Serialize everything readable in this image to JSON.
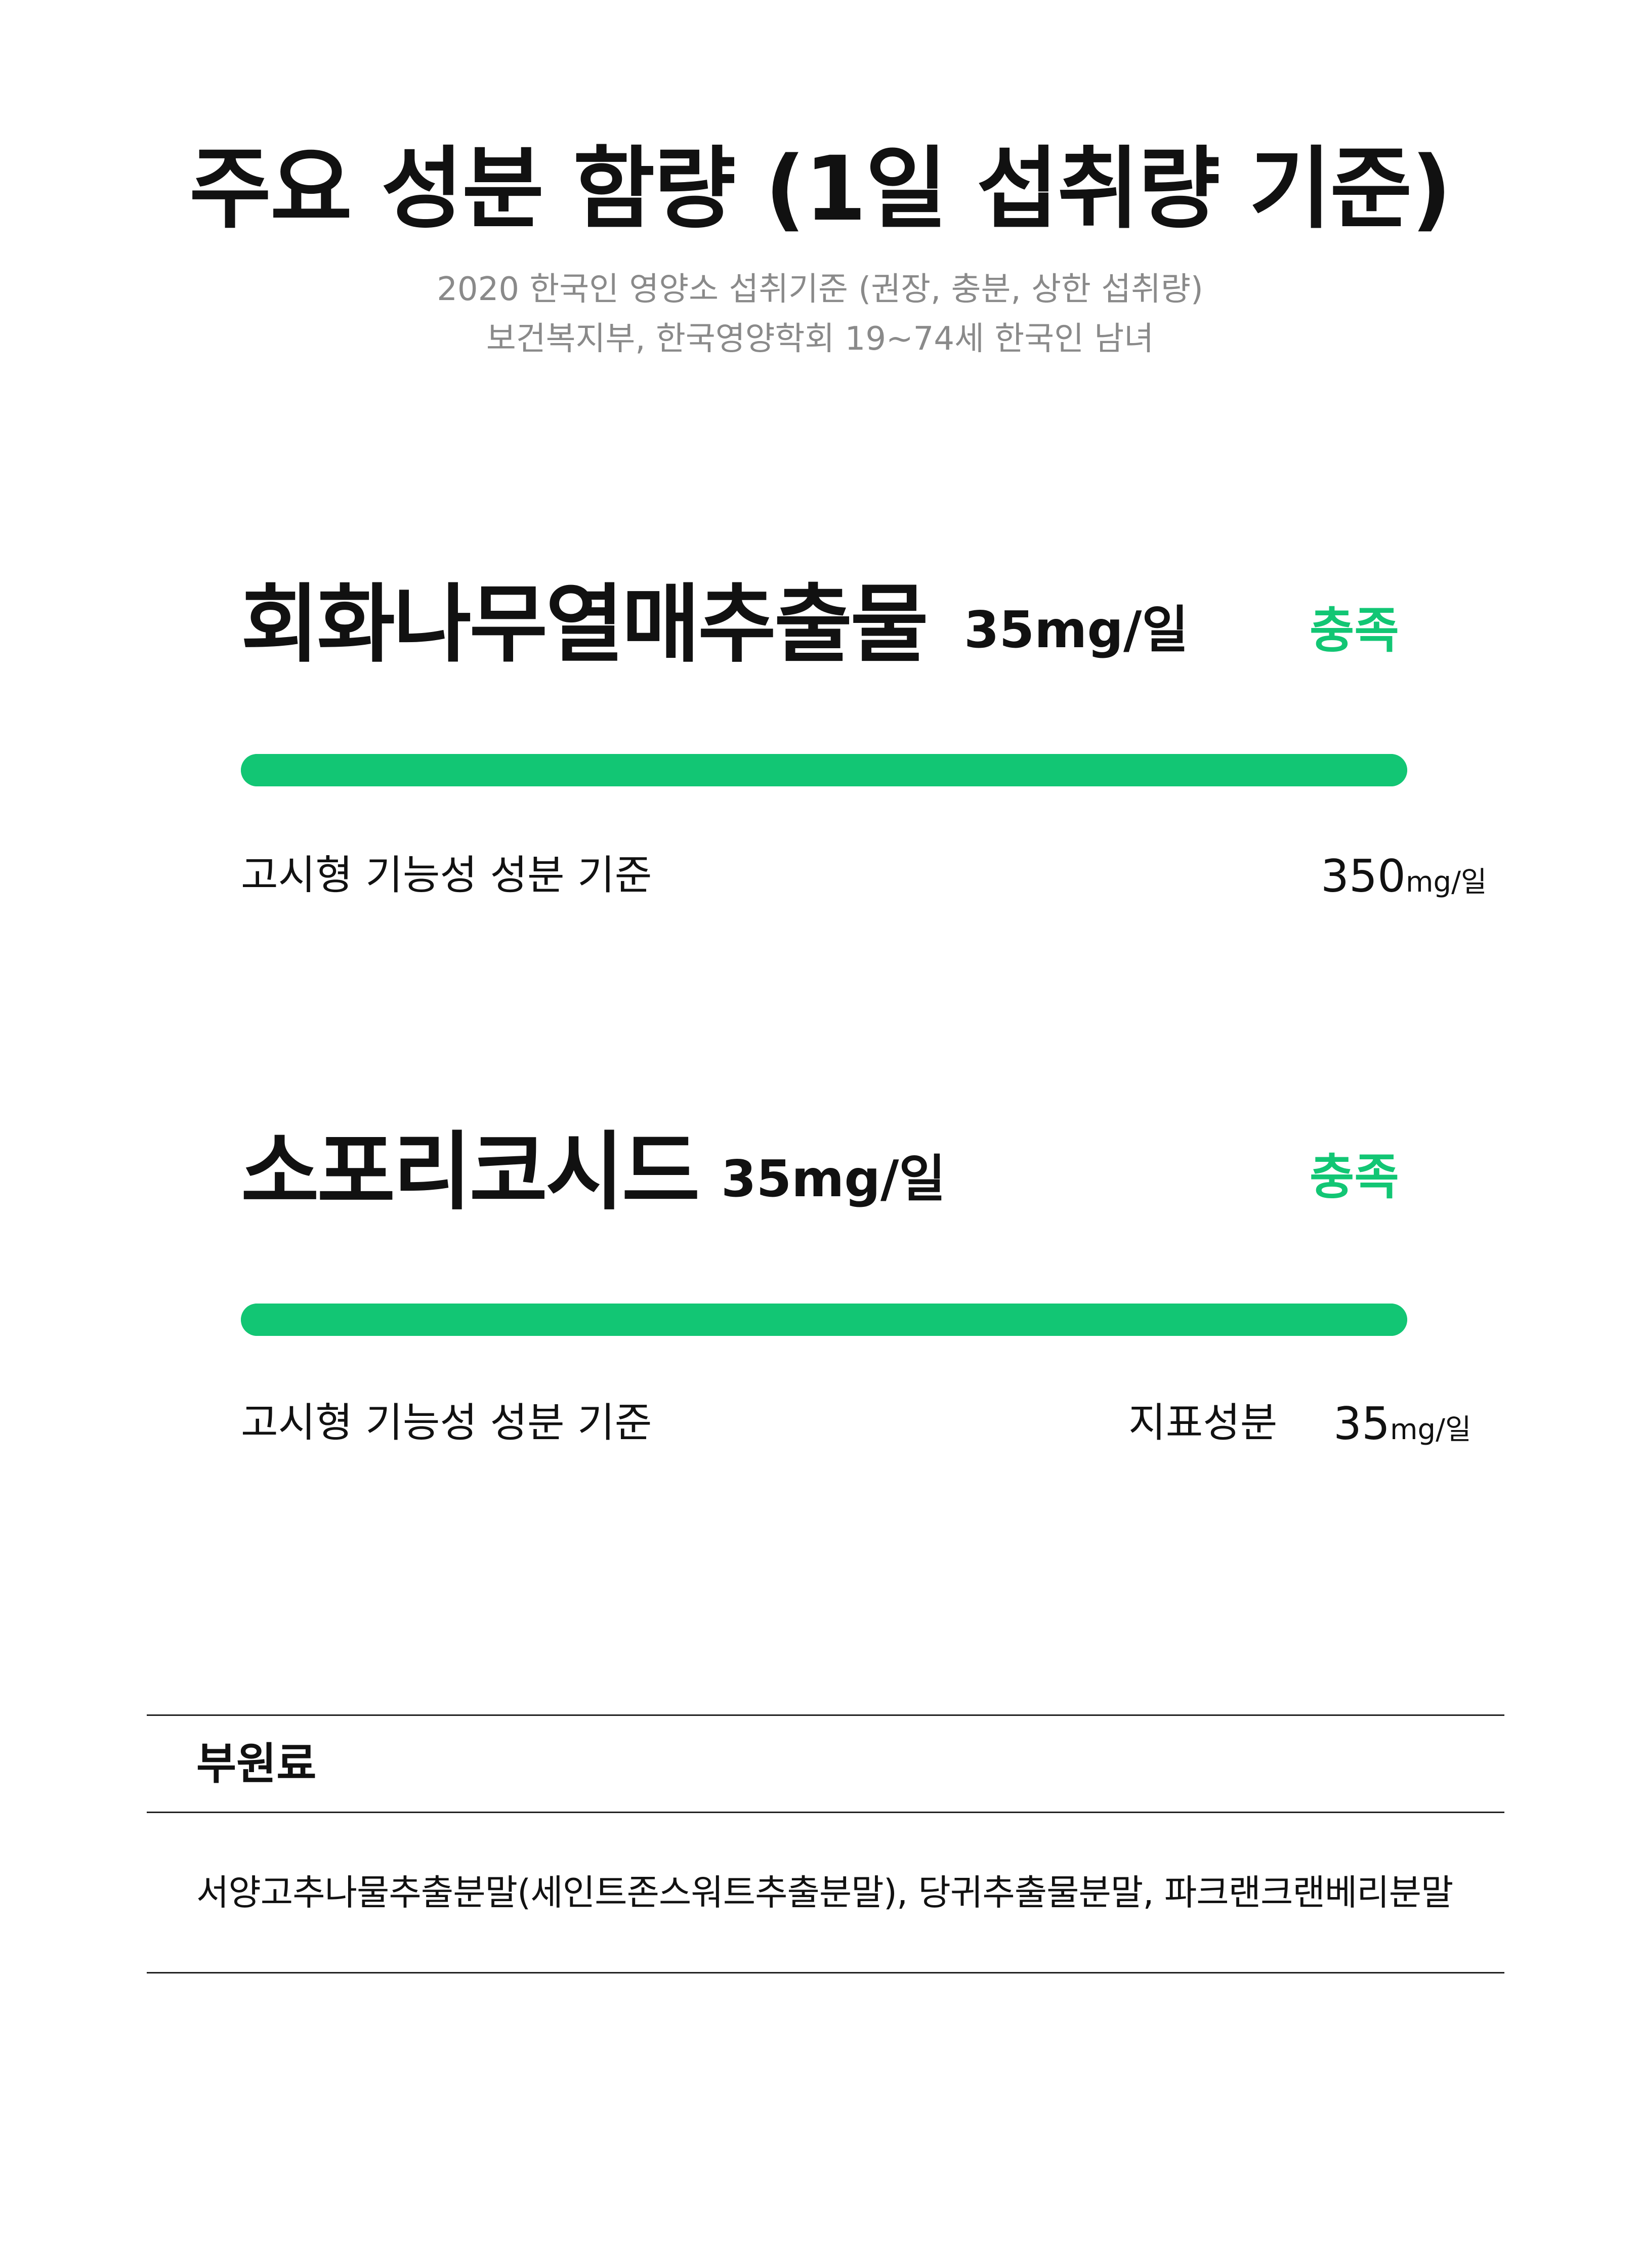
{
  "header": {
    "title": "주요 성분 함량 (1일 섭취량 기준)",
    "subtitle_line1": "2020 한국인 영양소 섭취기준 (권장, 충분, 상한 섭취량)",
    "subtitle_line2": "보건복지부, 한국영양학회  19~74세 한국인 남녀"
  },
  "ingredients": [
    {
      "name": "회화나무열매추출물",
      "amount": "35mg/일",
      "status": "충족",
      "progress_fraction": 1.0,
      "standard_label": "고시형 기능성 성분 기준",
      "standard_value": "350",
      "standard_unit": "mg/일"
    },
    {
      "name": "소포리코시드",
      "amount": "35mg/일",
      "status": "충족",
      "progress_fraction": 1.0,
      "standard_label": "고시형 기능성 성분 기준",
      "indicator_label": "지표성분",
      "standard_value": "35",
      "standard_unit": "mg/일"
    }
  ],
  "sub_ingredients": {
    "title": "부원료",
    "text": "서양고추나물추출분말(세인트존스워트추출분말), 당귀추출물분말, 파크랜크랜베리분말"
  },
  "colors": {
    "accent": "#12c674",
    "text": "#111111",
    "muted": "#8a8a8a"
  }
}
